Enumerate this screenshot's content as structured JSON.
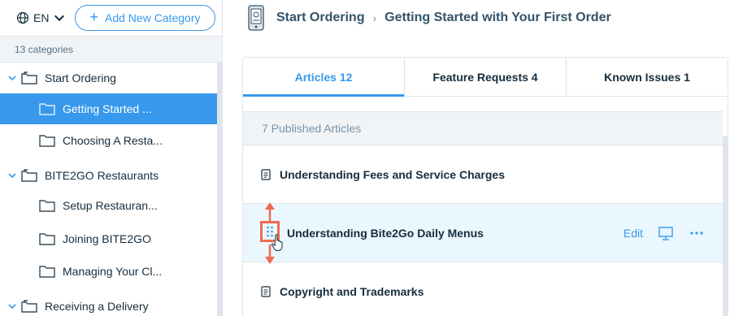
{
  "sidebar": {
    "language": "EN",
    "add_category_label": "Add New Category",
    "category_count": "13 categories",
    "tree": [
      {
        "type": "category",
        "label": "Start Ordering",
        "top": 0
      },
      {
        "type": "article",
        "label": "Getting Started ...",
        "active": true
      },
      {
        "type": "article",
        "label": "Choosing A Resta..."
      },
      {
        "type": "category",
        "label": "BITE2GO Restaurants"
      },
      {
        "type": "article",
        "label": "Setup Restauran..."
      },
      {
        "type": "article",
        "label": "Joining BITE2GO"
      },
      {
        "type": "article",
        "label": "Managing Your Cl..."
      },
      {
        "type": "category",
        "label": "Receiving a Delivery"
      }
    ]
  },
  "header": {
    "crumb_parent": "Start Ordering",
    "crumb_separator": "›",
    "crumb_current": "Getting Started with Your First Order"
  },
  "tabs": [
    {
      "label": "Articles 12",
      "active": true
    },
    {
      "label": "Feature Requests 4",
      "active": false
    },
    {
      "label": "Known Issues 1",
      "active": false
    }
  ],
  "articles_section": {
    "published_label": "7 Published Articles",
    "items": [
      {
        "title": "Understanding Fees and Service Charges"
      },
      {
        "title": "Understanding Bite2Go Daily Menus",
        "hover": true,
        "edit_label": "Edit"
      },
      {
        "title": "Copyright and Trademarks"
      }
    ]
  },
  "colors": {
    "accent": "#3899ec",
    "highlight": "#f06a4e",
    "hover_row": "#eaf7ff",
    "text_primary": "#162d3d"
  },
  "icons": [
    "globe-icon",
    "chevron-down-icon",
    "plus-icon",
    "folder-icon",
    "document-icon",
    "drag-handle-icon",
    "presentation-icon",
    "more-icon",
    "hand-cursor-icon"
  ]
}
